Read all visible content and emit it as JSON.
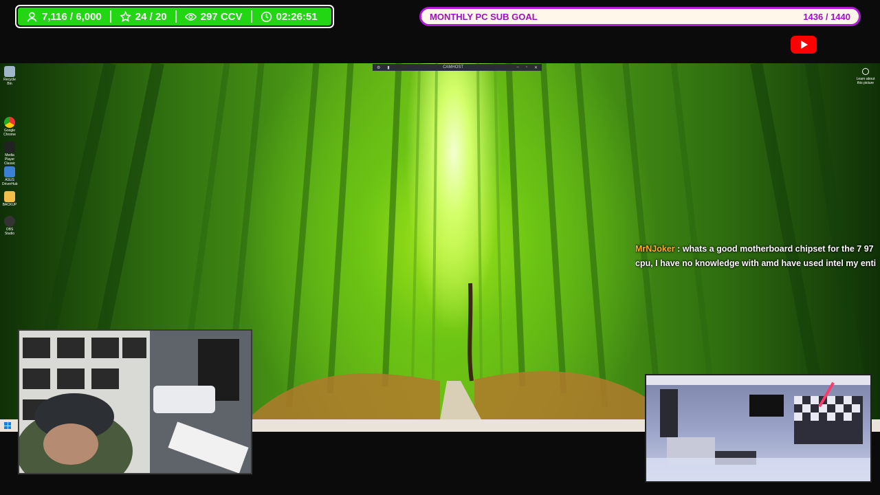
{
  "stats": {
    "followers": "7,116 / 6,000",
    "subs": "24 / 20",
    "viewers": "297 CCV",
    "uptime": "02:26:51"
  },
  "goal": {
    "title": "MONTHLY PC SUB GOAL",
    "progress": "1436 / 1440",
    "fraction": 0.997
  },
  "camhost": {
    "title": "CAMHOST"
  },
  "desktop_icons": [
    {
      "label": "Recycle Bin",
      "icon": "recycle-bin-icon"
    },
    {
      "label": "Google Chrome",
      "icon": "chrome-icon"
    },
    {
      "label": "Media Player Classic",
      "icon": "media-player-icon"
    },
    {
      "label": "ASUS DriverHub",
      "icon": "asus-icon"
    },
    {
      "label": "BACKUP",
      "icon": "folder-icon"
    },
    {
      "label": "OBS Studio",
      "icon": "obs-icon"
    }
  ],
  "corner_label": "Learn about this picture",
  "chat": {
    "user": "MrNJoker",
    "separator": " : ",
    "line1": "whats a good motherboard chipset for the 7 97",
    "line2": "cpu, I have no knowledge with amd have used intel my enti"
  },
  "colors": {
    "stats_green": "#22d614",
    "goal_border": "#b21ad8",
    "goal_text": "#9a12c2",
    "chat_user": "#ffae2b",
    "youtube_red": "#ff0000"
  }
}
